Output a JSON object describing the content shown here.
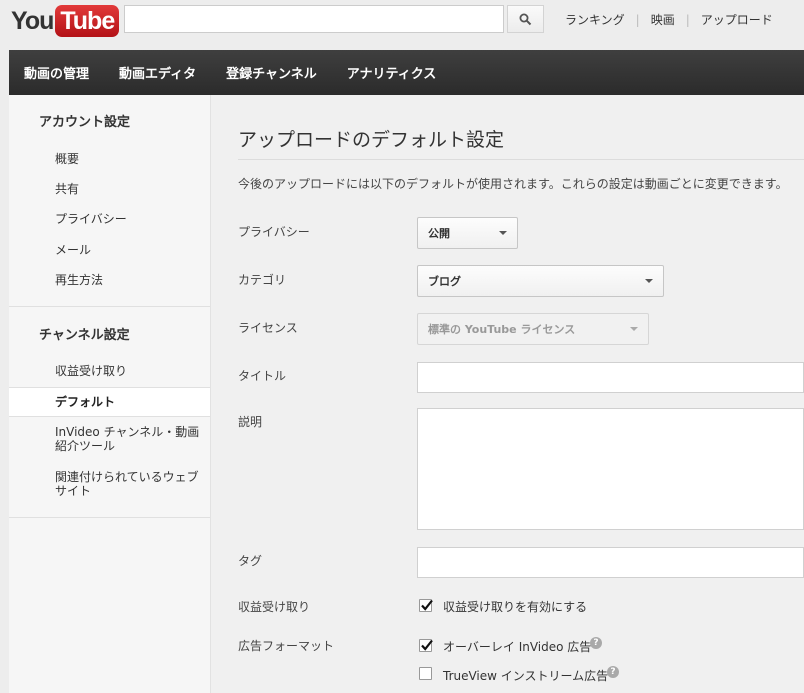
{
  "header": {
    "logo_you": "You",
    "logo_tube": "Tube",
    "search_placeholder": "",
    "links": [
      "ランキング",
      "映画",
      "アップロード"
    ]
  },
  "nav": {
    "items": [
      "動画の管理",
      "動画エディタ",
      "登録チャンネル",
      "アナリティクス"
    ]
  },
  "sidebar": {
    "account_heading": "アカウント設定",
    "account_items": [
      "概要",
      "共有",
      "プライバシー",
      "メール",
      "再生方法"
    ],
    "channel_heading": "チャンネル設定",
    "channel_items": [
      {
        "label": "収益受け取り",
        "active": false
      },
      {
        "label": "デフォルト",
        "active": true
      },
      {
        "label": "InVideo チャンネル・動画紹介ツール",
        "active": false
      },
      {
        "label": "関連付けられているウェブサイト",
        "active": false
      }
    ]
  },
  "main": {
    "title": "アップロードのデフォルト設定",
    "description": "今後のアップロードには以下のデフォルトが使用されます。これらの設定は動画ごとに変更できます。",
    "fields": {
      "privacy_label": "プライバシー",
      "privacy_value": "公開",
      "category_label": "カテゴリ",
      "category_value": "ブログ",
      "license_label": "ライセンス",
      "license_value": "標準の YouTube ライセンス",
      "title_label": "タイトル",
      "title_value": "",
      "description_label": "説明",
      "description_value": "",
      "tags_label": "タグ",
      "tags_value": "",
      "monetize_label": "収益受け取り",
      "monetize_checkbox_label": "収益受け取りを有効にする",
      "monetize_checked": true,
      "ad_format_label": "広告フォーマット",
      "overlay_label": "オーバーレイ InVideo 広告",
      "overlay_checked": true,
      "trueview_label": "TrueView インストリーム広告",
      "trueview_checked": false
    }
  },
  "colors": {
    "nav_bg": "#333333",
    "logo_red": "#cc181e"
  },
  "icons": {
    "search": "search-icon",
    "help": "help-icon",
    "dropdown": "chevron-down-icon",
    "check": "checkmark-icon"
  }
}
